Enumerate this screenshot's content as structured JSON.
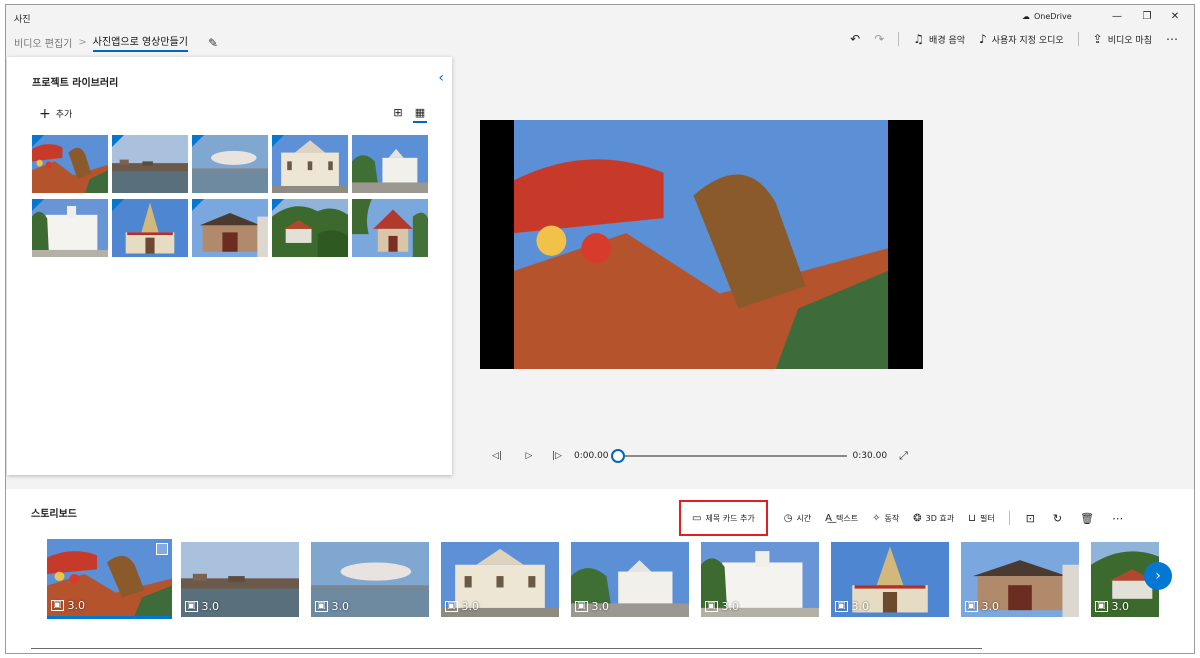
{
  "app": {
    "title": "사진",
    "onedrive": "OneDrive",
    "window_buttons": [
      "—",
      "❐",
      "✕"
    ]
  },
  "breadcrumb": {
    "prev": "비디오 편집기",
    "separator": ">",
    "current": "사진앱으로 영상만들기"
  },
  "top_actions": {
    "undo_icon": "↶",
    "redo_icon": "↷",
    "bg_music": "배경 음악",
    "custom_audio": "사용자 지정 오디오",
    "finish_video": "비디오 마침",
    "more": "⋯"
  },
  "library": {
    "title": "프로젝트 라이브러리",
    "collapse_icon": "‹",
    "add": "추가",
    "add_icon": "+",
    "view_large_icon": "⊞",
    "view_small_icon": "▦",
    "thumbnails": [
      {
        "scene": "dragon",
        "used": true
      },
      {
        "scene": "pier",
        "used": true
      },
      {
        "scene": "sea",
        "used": true
      },
      {
        "scene": "mansion",
        "used": true
      },
      {
        "scene": "white",
        "used": false
      },
      {
        "scene": "colonial",
        "used": true
      },
      {
        "scene": "temple",
        "used": true
      },
      {
        "scene": "clan",
        "used": true
      },
      {
        "scene": "jungle",
        "used": true
      },
      {
        "scene": "gate",
        "used": false
      }
    ]
  },
  "player": {
    "prev_icon": "◁|",
    "play_icon": "▷",
    "next_icon": "|▷",
    "current_time": "0:00.00",
    "total_time": "0:30.00",
    "expand_icon": "⤢",
    "progress": 0
  },
  "storyboard": {
    "title": "스토리보드",
    "tools": {
      "title_card": "제목 카드 추가",
      "duration": "시간",
      "text": "텍스트",
      "motion": "동작",
      "effects_3d": "3D 효과",
      "filters": "필터"
    },
    "tool_icons": {
      "title_card": "▭",
      "duration": "◷",
      "text": "A͟",
      "motion": "✧",
      "effects_3d": "❂",
      "filters": "⊔",
      "resize": "⊡",
      "rotate": "↻",
      "delete": "🗑",
      "more": "⋯"
    },
    "clips": [
      {
        "duration": "3.0",
        "scene": "dragon",
        "selected": true
      },
      {
        "duration": "3.0",
        "scene": "pier",
        "selected": false
      },
      {
        "duration": "3.0",
        "scene": "sea",
        "selected": false
      },
      {
        "duration": "3.0",
        "scene": "mansion",
        "selected": false
      },
      {
        "duration": "3.0",
        "scene": "white",
        "selected": false
      },
      {
        "duration": "3.0",
        "scene": "colonial",
        "selected": false
      },
      {
        "duration": "3.0",
        "scene": "temple",
        "selected": false
      },
      {
        "duration": "3.0",
        "scene": "clan",
        "selected": false
      },
      {
        "duration": "3.0",
        "scene": "jungle",
        "selected": false
      }
    ],
    "next_icon": "›"
  },
  "colors": {
    "accent": "#0078d4",
    "highlight": "#e02020"
  }
}
